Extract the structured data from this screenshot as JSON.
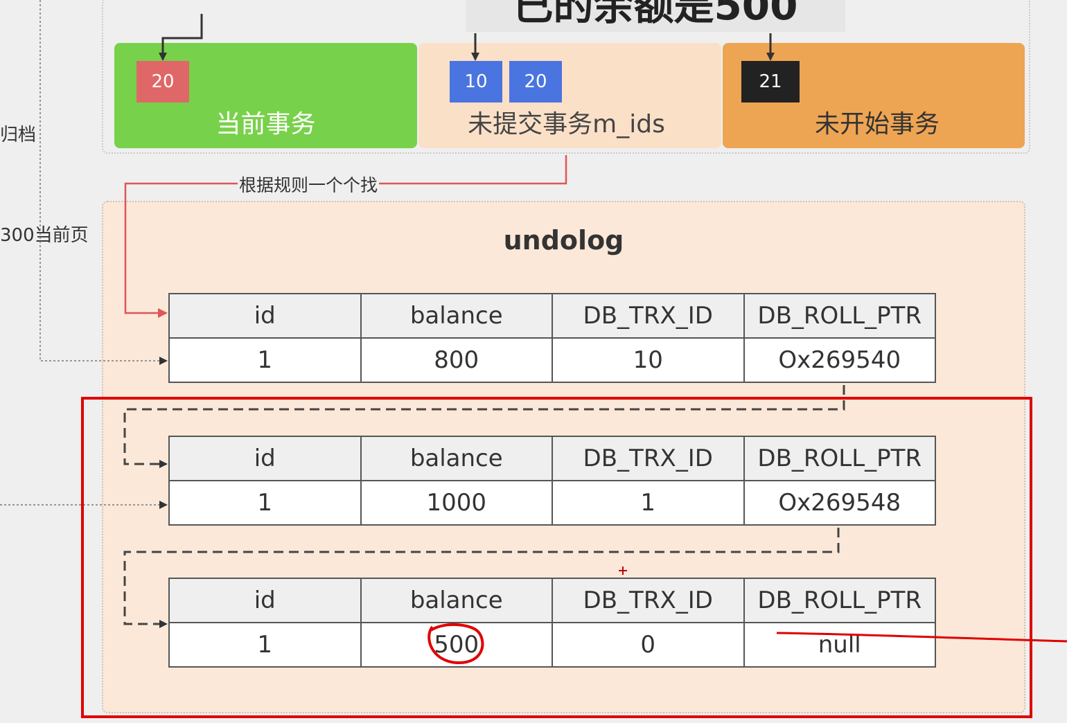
{
  "top_title": "已的余额是500",
  "side_notes": {
    "archive": "归档",
    "current_page": "300当前页"
  },
  "readview": {
    "current": {
      "label": "当前事务",
      "chips": [
        "20"
      ]
    },
    "uncommitted": {
      "label": "未提交事务m_ids",
      "chips": [
        "10",
        "20"
      ]
    },
    "not_started": {
      "label": "未开始事务",
      "chips": [
        "21"
      ]
    }
  },
  "rule_label": "根据规则一个个找",
  "undolog": {
    "title": "undolog",
    "columns": [
      "id",
      "balance",
      "DB_TRX_ID",
      "DB_ROLL_PTR"
    ],
    "records": [
      [
        "1",
        "800",
        "10",
        "Ox269540"
      ],
      [
        "1",
        "1000",
        "1",
        "Ox269548"
      ],
      [
        "1",
        "500",
        "0",
        "null"
      ]
    ]
  },
  "colors": {
    "current": "#78d14a",
    "uncommitted": "#fbe0c8",
    "not_started": "#eea553",
    "chip_current": "#e06767",
    "chip_uncommitted": "#4a74e0",
    "chip_not_started": "#222222",
    "annotation_red": "#e00000"
  }
}
